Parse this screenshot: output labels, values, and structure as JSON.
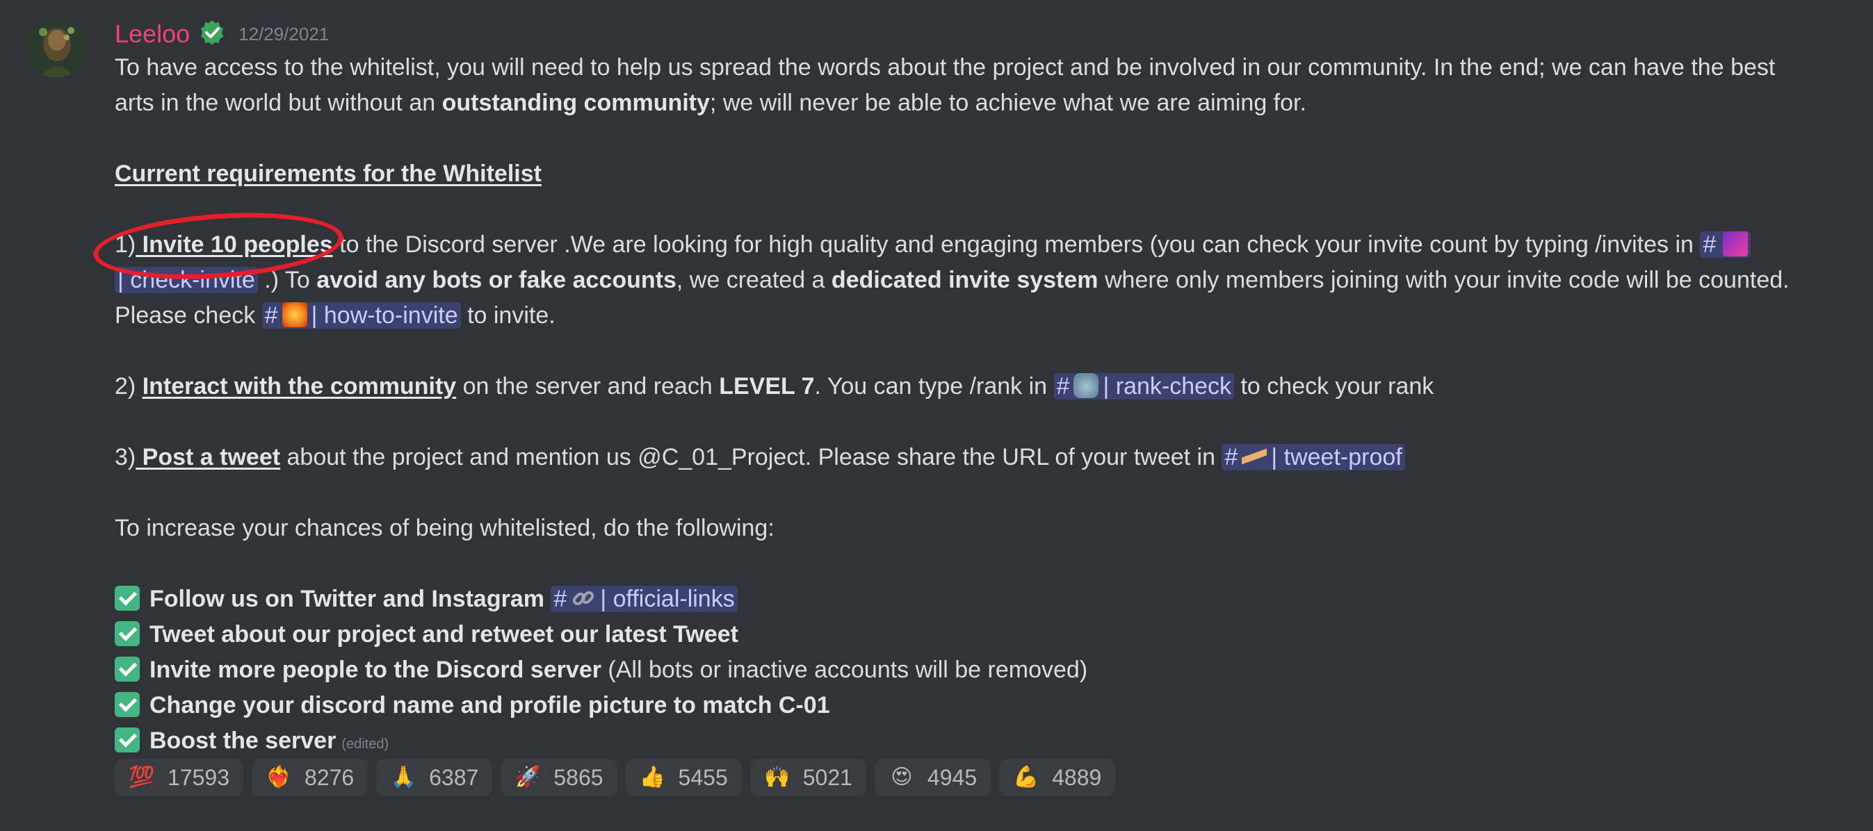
{
  "message": {
    "author": "Leeloo",
    "timestamp": "12/29/2021",
    "intro_line1": "To have access to the whitelist, you will need to help us spread the words about the project and be involved in our community. In the end; we can have the best",
    "intro_line2_a": "arts in the world but without an ",
    "intro_line2_b": "outstanding community",
    "intro_line2_c": "; we will never be able to achieve what we are aiming for.",
    "heading": "Current requirements for the Whitelist",
    "req1_prefix": "1)",
    "req1_bold": " Invite 10 peoples",
    "req1_text": " to the Discord server .We are looking for high quality and engaging members (you can check your invite count by typing /invites in ",
    "req1_channel": "| check-invite",
    "req1_text2": " .) To ",
    "req1_bold2": "avoid any bots or fake accounts",
    "req1_text3": ", we created a ",
    "req1_bold3": "dedicated invite system",
    "req1_text4": " where only members joining with your invite code will be counted.",
    "req1_text5": "Please check ",
    "req1_channel2": "| how-to-invite",
    "req1_text6": " to invite.",
    "req2_prefix": "2) ",
    "req2_bold": "Interact with the community",
    "req2_text": " on the server and reach ",
    "req2_bold2": "LEVEL 7",
    "req2_text2": ". You can type /rank in ",
    "req2_channel": "| rank-check",
    "req2_text3": " to check your rank",
    "req3_prefix": "3)",
    "req3_bold": " Post a tweet",
    "req3_text": " about the project and mention us @C_01_Project. Please share the URL of your tweet in ",
    "req3_channel": "| tweet-proof",
    "increase": "To increase your chances of being whitelisted, do the following:",
    "checklist": [
      {
        "bold": "Follow us on Twitter and Instagram",
        "channel": "| official-links",
        "rest": ""
      },
      {
        "bold": "Tweet about our project and retweet our latest Tweet",
        "channel": "",
        "rest": ""
      },
      {
        "bold": "Invite more people to the Discord server",
        "channel": "",
        "rest": " (All bots or inactive accounts will be removed)"
      },
      {
        "bold": "Change your discord name and profile picture to match C-01",
        "channel": "",
        "rest": ""
      },
      {
        "bold": "Boost the server",
        "channel": "",
        "rest": ""
      }
    ],
    "edited_label": "(edited)",
    "hash": "#"
  },
  "reactions": [
    {
      "emoji": "💯",
      "icon": "hundred-icon",
      "count": "17593"
    },
    {
      "emoji": "❤️‍🔥",
      "icon": "heart-on-fire-icon",
      "count": "8276"
    },
    {
      "emoji": "🙏",
      "icon": "folded-hands-icon",
      "count": "6387"
    },
    {
      "emoji": "🚀",
      "icon": "rocket-icon",
      "count": "5865"
    },
    {
      "emoji": "👍",
      "icon": "thumbs-up-icon",
      "count": "5455"
    },
    {
      "emoji": "🙌",
      "icon": "raised-hands-icon",
      "count": "5021"
    },
    {
      "emoji": "😍",
      "icon": "heart-eyes-icon",
      "count": "4945"
    },
    {
      "emoji": "💪",
      "icon": "flexed-biceps-icon",
      "count": "4889"
    }
  ],
  "colors": {
    "background": "#313338",
    "username": "#f23f7f",
    "mention_bg": "#3c4270",
    "check_green": "#43b581",
    "annotation_red": "#e41e2b"
  }
}
